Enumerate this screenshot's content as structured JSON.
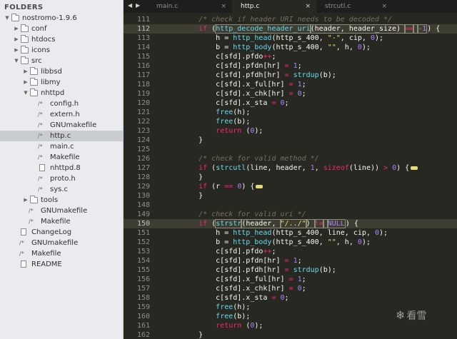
{
  "sidebar": {
    "header": "FOLDERS",
    "tree": [
      {
        "label": "nostromo-1.9.6",
        "kind": "folder",
        "expanded": true,
        "depth": 0
      },
      {
        "label": "conf",
        "kind": "folder",
        "expanded": false,
        "depth": 1
      },
      {
        "label": "htdocs",
        "kind": "folder",
        "expanded": false,
        "depth": 1
      },
      {
        "label": "icons",
        "kind": "folder",
        "expanded": false,
        "depth": 1
      },
      {
        "label": "src",
        "kind": "folder",
        "expanded": true,
        "depth": 1
      },
      {
        "label": "libbsd",
        "kind": "folder",
        "expanded": false,
        "depth": 2
      },
      {
        "label": "libmy",
        "kind": "folder",
        "expanded": false,
        "depth": 2
      },
      {
        "label": "nhttpd",
        "kind": "folder",
        "expanded": true,
        "depth": 2
      },
      {
        "label": "config.h",
        "kind": "code",
        "depth": 3
      },
      {
        "label": "extern.h",
        "kind": "code",
        "depth": 3
      },
      {
        "label": "GNUmakefile",
        "kind": "code",
        "depth": 3
      },
      {
        "label": "http.c",
        "kind": "code",
        "depth": 3,
        "selected": true
      },
      {
        "label": "main.c",
        "kind": "code",
        "depth": 3
      },
      {
        "label": "Makefile",
        "kind": "code",
        "depth": 3
      },
      {
        "label": "nhttpd.8",
        "kind": "doc",
        "depth": 3
      },
      {
        "label": "proto.h",
        "kind": "code",
        "depth": 3
      },
      {
        "label": "sys.c",
        "kind": "code",
        "depth": 3
      },
      {
        "label": "tools",
        "kind": "folder",
        "expanded": false,
        "depth": 2
      },
      {
        "label": "GNUmakefile",
        "kind": "code",
        "depth": 2
      },
      {
        "label": "Makefile",
        "kind": "code",
        "depth": 2
      },
      {
        "label": "ChangeLog",
        "kind": "doc",
        "depth": 1
      },
      {
        "label": "GNUmakefile",
        "kind": "code",
        "depth": 1
      },
      {
        "label": "Makefile",
        "kind": "code",
        "depth": 1
      },
      {
        "label": "README",
        "kind": "doc",
        "depth": 1
      }
    ]
  },
  "tabs": [
    {
      "label": "main.c",
      "active": false,
      "close": "×"
    },
    {
      "label": "http.c",
      "active": true,
      "close": "×"
    },
    {
      "label": "strcutl.c",
      "active": false,
      "close": "×"
    }
  ],
  "nav": {
    "left": "◀",
    "right": "▶"
  },
  "editor": {
    "lines": [
      {
        "n": "111",
        "tokens": [
          [
            "    ",
            "p"
          ],
          [
            "/* check if header URI needs to be decoded */",
            "com"
          ]
        ]
      },
      {
        "n": "112",
        "hl": true,
        "tokens": [
          [
            "    ",
            "p"
          ],
          [
            "if",
            "kw"
          ],
          [
            " (",
            "p"
          ],
          [
            "http_decode_header_uri",
            "fn",
            "sel"
          ],
          [
            "(header, header_size) ",
            "p",
            "sel"
          ],
          [
            "==",
            "op",
            "sel"
          ],
          [
            " ",
            "p",
            "sel"
          ],
          [
            "-1",
            "num",
            "sel"
          ],
          [
            "",
            "cursor"
          ],
          [
            ") {",
            "p"
          ]
        ]
      },
      {
        "n": "113",
        "tokens": [
          [
            "        h = ",
            "p"
          ],
          [
            "http_head",
            "fn"
          ],
          [
            "(http_s_400, ",
            "p"
          ],
          [
            "\"-\"",
            "str"
          ],
          [
            ", cip, ",
            "p"
          ],
          [
            "0",
            "num"
          ],
          [
            ");",
            "p"
          ]
        ]
      },
      {
        "n": "114",
        "tokens": [
          [
            "        b = ",
            "p"
          ],
          [
            "http_body",
            "fn"
          ],
          [
            "(http_s_400, ",
            "p"
          ],
          [
            "\"\"",
            "str"
          ],
          [
            ", h, ",
            "p"
          ],
          [
            "0",
            "num"
          ],
          [
            ");",
            "p"
          ]
        ]
      },
      {
        "n": "115",
        "tokens": [
          [
            "        c[sfd].pfdo",
            "p"
          ],
          [
            "++",
            "op"
          ],
          [
            ";",
            "p"
          ]
        ]
      },
      {
        "n": "116",
        "tokens": [
          [
            "        c[sfd].pfdn[hr] ",
            "p"
          ],
          [
            "=",
            "op"
          ],
          [
            " ",
            "p"
          ],
          [
            "1",
            "num"
          ],
          [
            ";",
            "p"
          ]
        ]
      },
      {
        "n": "117",
        "tokens": [
          [
            "        c[sfd].pfdh[hr] ",
            "p"
          ],
          [
            "=",
            "op"
          ],
          [
            " ",
            "p"
          ],
          [
            "strdup",
            "fn"
          ],
          [
            "(b);",
            "p"
          ]
        ]
      },
      {
        "n": "118",
        "tokens": [
          [
            "        c[sfd].x_ful[hr] ",
            "p"
          ],
          [
            "=",
            "op"
          ],
          [
            " ",
            "p"
          ],
          [
            "1",
            "num"
          ],
          [
            ";",
            "p"
          ]
        ]
      },
      {
        "n": "119",
        "tokens": [
          [
            "        c[sfd].x_chk[hr] ",
            "p"
          ],
          [
            "=",
            "op"
          ],
          [
            " ",
            "p"
          ],
          [
            "0",
            "num"
          ],
          [
            ";",
            "p"
          ]
        ]
      },
      {
        "n": "120",
        "tokens": [
          [
            "        c[sfd].x_sta ",
            "p"
          ],
          [
            "=",
            "op"
          ],
          [
            " ",
            "p"
          ],
          [
            "0",
            "num"
          ],
          [
            ";",
            "p"
          ]
        ]
      },
      {
        "n": "121",
        "tokens": [
          [
            "        ",
            "p"
          ],
          [
            "free",
            "fn"
          ],
          [
            "(h);",
            "p"
          ]
        ]
      },
      {
        "n": "122",
        "tokens": [
          [
            "        ",
            "p"
          ],
          [
            "free",
            "fn"
          ],
          [
            "(b);",
            "p"
          ]
        ]
      },
      {
        "n": "123",
        "tokens": [
          [
            "        ",
            "p"
          ],
          [
            "return",
            "kw"
          ],
          [
            " (",
            "p"
          ],
          [
            "0",
            "num"
          ],
          [
            ");",
            "p"
          ]
        ]
      },
      {
        "n": "124",
        "tokens": [
          [
            "    }",
            "p"
          ]
        ]
      },
      {
        "n": "125",
        "tokens": []
      },
      {
        "n": "126",
        "tokens": [
          [
            "    ",
            "p"
          ],
          [
            "/* check for valid method */",
            "com"
          ]
        ]
      },
      {
        "n": "127",
        "tokens": [
          [
            "    ",
            "p"
          ],
          [
            "if",
            "kw"
          ],
          [
            " (",
            "p"
          ],
          [
            "strcutl",
            "fn"
          ],
          [
            "(line, header, ",
            "p"
          ],
          [
            "1",
            "num"
          ],
          [
            ", ",
            "p"
          ],
          [
            "sizeof",
            "kw"
          ],
          [
            "(line)) ",
            "p"
          ],
          [
            ">",
            "op"
          ],
          [
            " ",
            "p"
          ],
          [
            "0",
            "num"
          ],
          [
            ") {",
            "p"
          ],
          [
            "",
            "fold"
          ]
        ]
      },
      {
        "n": "128",
        "tokens": [
          [
            "    }",
            "p"
          ]
        ]
      },
      {
        "n": "129",
        "tokens": [
          [
            "    ",
            "p"
          ],
          [
            "if",
            "kw"
          ],
          [
            " (r ",
            "p"
          ],
          [
            "==",
            "op"
          ],
          [
            " ",
            "p"
          ],
          [
            "0",
            "num"
          ],
          [
            ") {",
            "p"
          ],
          [
            "",
            "fold"
          ]
        ]
      },
      {
        "n": "130",
        "tokens": [
          [
            "    }",
            "p"
          ]
        ]
      },
      {
        "n": "148",
        "tokens": []
      },
      {
        "n": "149",
        "tokens": [
          [
            "    ",
            "p"
          ],
          [
            "/* check for valid uri */",
            "com"
          ]
        ]
      },
      {
        "n": "150",
        "hl": true,
        "tokens": [
          [
            "    ",
            "p"
          ],
          [
            "if",
            "kw"
          ],
          [
            " (",
            "p"
          ],
          [
            "strstr",
            "fn",
            "sel"
          ],
          [
            "(header, ",
            "p",
            "sel"
          ],
          [
            "\"/../\"",
            "str",
            "sel"
          ],
          [
            ") ",
            "p",
            "sel"
          ],
          [
            "!=",
            "op",
            "sel"
          ],
          [
            " ",
            "p",
            "sel"
          ],
          [
            "NULL",
            "num",
            "sel"
          ],
          [
            "",
            "cursor"
          ],
          [
            ") {",
            "p"
          ]
        ]
      },
      {
        "n": "151",
        "tokens": [
          [
            "        h = ",
            "p"
          ],
          [
            "http_head",
            "fn"
          ],
          [
            "(http_s_400, line, cip, ",
            "p"
          ],
          [
            "0",
            "num"
          ],
          [
            ");",
            "p"
          ]
        ]
      },
      {
        "n": "152",
        "tokens": [
          [
            "        b = ",
            "p"
          ],
          [
            "http_body",
            "fn"
          ],
          [
            "(http_s_400, ",
            "p"
          ],
          [
            "\"\"",
            "str"
          ],
          [
            ", h, ",
            "p"
          ],
          [
            "0",
            "num"
          ],
          [
            ");",
            "p"
          ]
        ]
      },
      {
        "n": "153",
        "tokens": [
          [
            "        c[sfd].pfdo",
            "p"
          ],
          [
            "++",
            "op"
          ],
          [
            ";",
            "p"
          ]
        ]
      },
      {
        "n": "154",
        "tokens": [
          [
            "        c[sfd].pfdn[hr] ",
            "p"
          ],
          [
            "=",
            "op"
          ],
          [
            " ",
            "p"
          ],
          [
            "1",
            "num"
          ],
          [
            ";",
            "p"
          ]
        ]
      },
      {
        "n": "155",
        "tokens": [
          [
            "        c[sfd].pfdh[hr] ",
            "p"
          ],
          [
            "=",
            "op"
          ],
          [
            " ",
            "p"
          ],
          [
            "strdup",
            "fn"
          ],
          [
            "(b);",
            "p"
          ]
        ]
      },
      {
        "n": "156",
        "tokens": [
          [
            "        c[sfd].x_ful[hr] ",
            "p"
          ],
          [
            "=",
            "op"
          ],
          [
            " ",
            "p"
          ],
          [
            "1",
            "num"
          ],
          [
            ";",
            "p"
          ]
        ]
      },
      {
        "n": "157",
        "tokens": [
          [
            "        c[sfd].x_chk[hr] ",
            "p"
          ],
          [
            "=",
            "op"
          ],
          [
            " ",
            "p"
          ],
          [
            "0",
            "num"
          ],
          [
            ";",
            "p"
          ]
        ]
      },
      {
        "n": "158",
        "tokens": [
          [
            "        c[sfd].x_sta ",
            "p"
          ],
          [
            "=",
            "op"
          ],
          [
            " ",
            "p"
          ],
          [
            "0",
            "num"
          ],
          [
            ";",
            "p"
          ]
        ]
      },
      {
        "n": "159",
        "tokens": [
          [
            "        ",
            "p"
          ],
          [
            "free",
            "fn"
          ],
          [
            "(h);",
            "p"
          ]
        ]
      },
      {
        "n": "160",
        "tokens": [
          [
            "        ",
            "p"
          ],
          [
            "free",
            "fn"
          ],
          [
            "(b);",
            "p"
          ]
        ]
      },
      {
        "n": "161",
        "tokens": [
          [
            "        ",
            "p"
          ],
          [
            "return",
            "kw"
          ],
          [
            " (",
            "p"
          ],
          [
            "0",
            "num"
          ],
          [
            ");",
            "p"
          ]
        ]
      },
      {
        "n": "162",
        "tokens": [
          [
            "    }",
            "p"
          ]
        ]
      }
    ]
  },
  "watermark": {
    "icon": "❄",
    "text": "看雪"
  },
  "colors": {
    "editor_bg": "#272822",
    "keyword": "#f92672",
    "function": "#66d9ef",
    "string": "#e6db74",
    "number": "#ae81ff",
    "comment": "#75715e",
    "sidebar_bg": "#e9ebee"
  }
}
